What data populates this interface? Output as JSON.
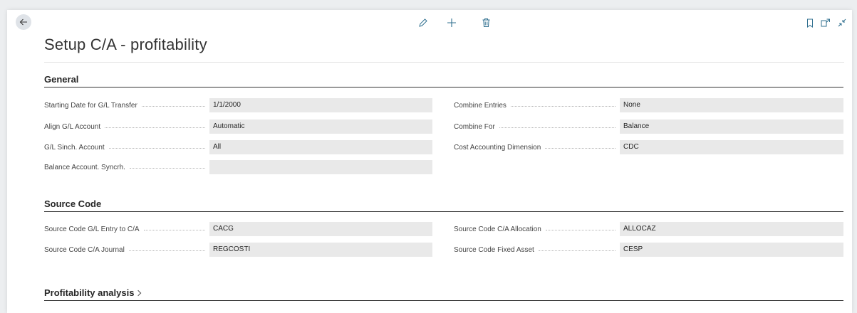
{
  "page": {
    "title": "Setup C/A - profitability"
  },
  "sections": {
    "general": {
      "title": "General",
      "left": [
        {
          "label": "Starting Date for G/L Transfer",
          "value": "1/1/2000"
        },
        {
          "label": "Align G/L Account",
          "value": "Automatic"
        },
        {
          "label": "G/L Sinch. Account",
          "value": "All"
        },
        {
          "label": "Balance Account. Syncrh.",
          "value": ""
        }
      ],
      "right": [
        {
          "label": "Combine Entries",
          "value": "None"
        },
        {
          "label": "Combine For",
          "value": "Balance"
        },
        {
          "label": "Cost Accounting Dimension",
          "value": "CDC"
        }
      ]
    },
    "source_code": {
      "title": "Source Code",
      "left": [
        {
          "label": "Source Code G/L Entry to C/A",
          "value": "CACG"
        },
        {
          "label": "Source Code C/A Journal",
          "value": "REGCOSTI"
        }
      ],
      "right": [
        {
          "label": "Source Code C/A Allocation",
          "value": "ALLOCAZ"
        },
        {
          "label": "Source Code Fixed Asset",
          "value": "CESP"
        }
      ]
    },
    "profitability": {
      "title": "Profitability analysis"
    }
  },
  "colors": {
    "accent": "#2f6f8f",
    "field_bg": "#e9e9e9",
    "back_bg": "#dfe3e8"
  }
}
